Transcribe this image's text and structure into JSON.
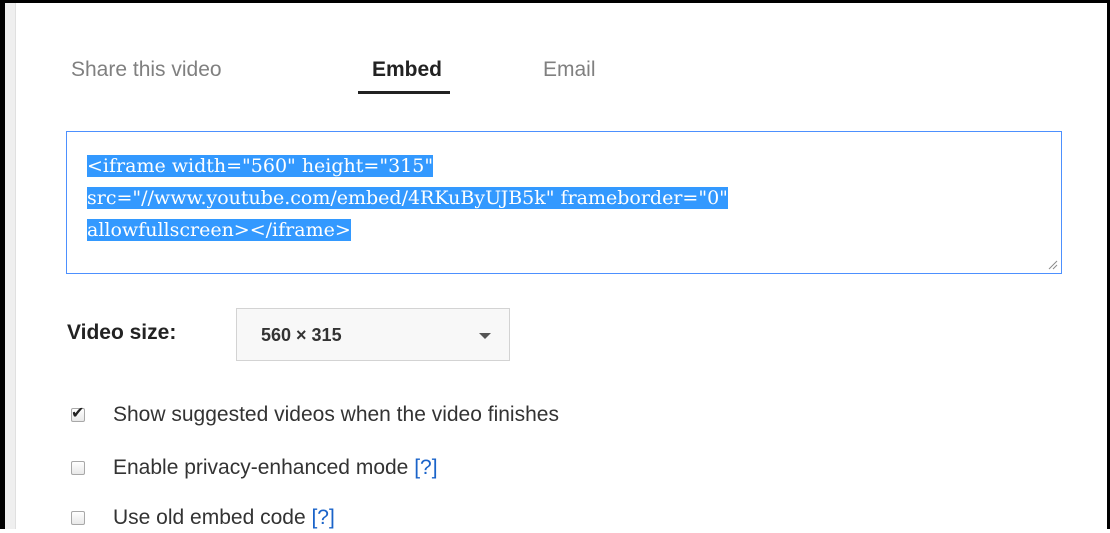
{
  "tabs": {
    "share": "Share this video",
    "embed": "Embed",
    "email": "Email",
    "active": "embed"
  },
  "embed_code": {
    "line1": "<iframe width=\"560\" height=\"315\"",
    "line2": "src=\"//www.youtube.com/embed/4RKuByUJB5k\" frameborder=\"0\"",
    "line3": "allowfullscreen></iframe>",
    "selected": true
  },
  "video_size": {
    "label": "Video size:",
    "selected": "560 × 315"
  },
  "options": {
    "suggested": {
      "label": "Show suggested videos when the video finishes",
      "checked": true
    },
    "privacy": {
      "label": "Enable privacy-enhanced mode",
      "help": "[?]",
      "checked": false
    },
    "old_embed": {
      "label": "Use old embed code",
      "help": "[?]",
      "checked": false
    }
  },
  "colors": {
    "selection": "#3399ff",
    "focus_border": "#4d90fe",
    "link": "#1a63c9"
  },
  "icons": {
    "dropdown": "chevron-down-icon",
    "check": "checkmark-icon",
    "resize": "resize-grip-icon"
  }
}
